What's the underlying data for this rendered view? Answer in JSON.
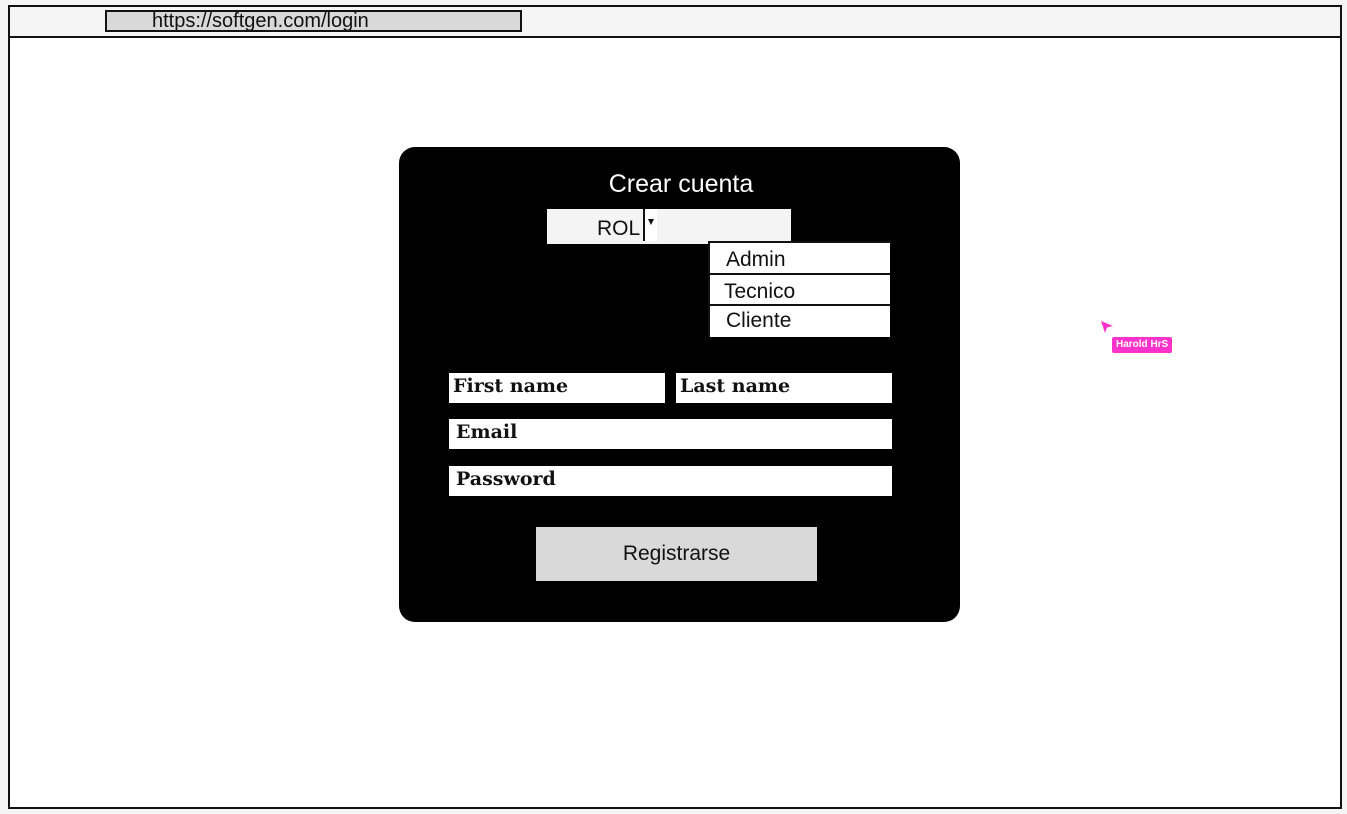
{
  "browser": {
    "url": "https://softgen.com/login"
  },
  "form": {
    "title": "Crear cuenta",
    "role_select": {
      "label": "ROL",
      "options": [
        "Admin",
        "Tecnico",
        "Cliente"
      ]
    },
    "fields": {
      "first_name": "First name",
      "last_name": "Last name",
      "email": "Email",
      "password": "Password"
    },
    "submit_label": "Registrarse"
  },
  "collaborator_cursor": {
    "name": "Harold HrS",
    "color": "#ff33cc"
  },
  "colors": {
    "card_background": "#000000",
    "select_background": "#f4f4f4",
    "button_background": "#d9d9d9",
    "url_bar_background": "#d9d9d9"
  }
}
